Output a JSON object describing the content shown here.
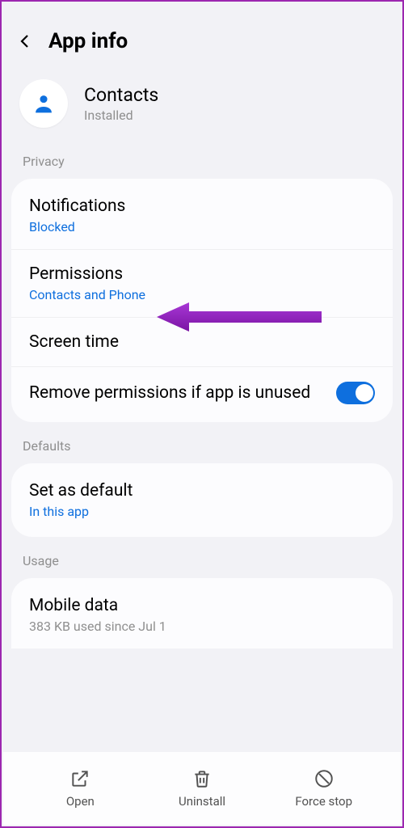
{
  "header": {
    "title": "App info"
  },
  "app": {
    "name": "Contacts",
    "status": "Installed"
  },
  "sections": {
    "privacy": {
      "label": "Privacy",
      "notifications": {
        "title": "Notifications",
        "sub": "Blocked"
      },
      "permissions": {
        "title": "Permissions",
        "sub": "Contacts and Phone"
      },
      "screen_time": {
        "title": "Screen time"
      },
      "remove_perms": {
        "title": "Remove permissions if app is unused",
        "toggled": true
      }
    },
    "defaults": {
      "label": "Defaults",
      "set_default": {
        "title": "Set as default",
        "sub": "In this app"
      }
    },
    "usage": {
      "label": "Usage",
      "mobile_data": {
        "title": "Mobile data",
        "sub": "383 KB used since Jul 1"
      }
    }
  },
  "bottom": {
    "open": "Open",
    "uninstall": "Uninstall",
    "force_stop": "Force stop"
  },
  "colors": {
    "accent": "#0e6fde",
    "arrow": "#8b1fb3"
  }
}
